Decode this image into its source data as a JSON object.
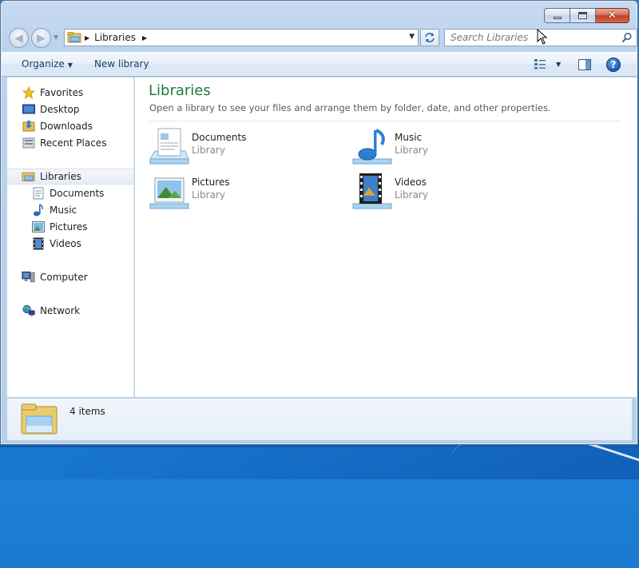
{
  "window": {
    "title": "",
    "caption_buttons": [
      "minimize-icon",
      "maximize-icon",
      "close-icon"
    ]
  },
  "navigation": {
    "address": {
      "folder": "Libraries"
    },
    "search": {
      "placeholder": "Search Libraries"
    }
  },
  "toolbar": {
    "organize_label": "Organize",
    "new_library_label": "New library"
  },
  "nav_pane": {
    "items": [
      {
        "id": "favorites",
        "label": "Favorites",
        "icon": "star-icon",
        "level": 0
      },
      {
        "id": "desktop",
        "label": "Desktop",
        "icon": "desktop-icon",
        "level": 1
      },
      {
        "id": "downloads",
        "label": "Downloads",
        "icon": "downloads-folder-icon",
        "level": 1
      },
      {
        "id": "recent-places",
        "label": "Recent Places",
        "icon": "recent-places-icon",
        "level": 1
      },
      {
        "id": "libraries",
        "label": "Libraries",
        "icon": "libraries-folder-icon",
        "level": 0,
        "selected": true
      },
      {
        "id": "documents",
        "label": "Documents",
        "icon": "document-icon",
        "level": 1
      },
      {
        "id": "music",
        "label": "Music",
        "icon": "music-note-icon",
        "level": 1
      },
      {
        "id": "pictures",
        "label": "Pictures",
        "icon": "picture-icon",
        "level": 1
      },
      {
        "id": "videos",
        "label": "Videos",
        "icon": "film-icon",
        "level": 1
      },
      {
        "id": "computer",
        "label": "Computer",
        "icon": "computer-icon",
        "level": 0
      },
      {
        "id": "network",
        "label": "Network",
        "icon": "network-icon",
        "level": 0
      }
    ]
  },
  "content": {
    "title": "Libraries",
    "subtitle": "Open a library to see your files and arrange them by folder, date, and other properties.",
    "libraries": [
      {
        "name": "Documents",
        "type": "Library",
        "icon": "documents-library-icon"
      },
      {
        "name": "Music",
        "type": "Library",
        "icon": "music-library-icon"
      },
      {
        "name": "Pictures",
        "type": "Library",
        "icon": "pictures-library-icon"
      },
      {
        "name": "Videos",
        "type": "Library",
        "icon": "videos-library-icon"
      }
    ]
  },
  "details": {
    "count": "4 items"
  }
}
